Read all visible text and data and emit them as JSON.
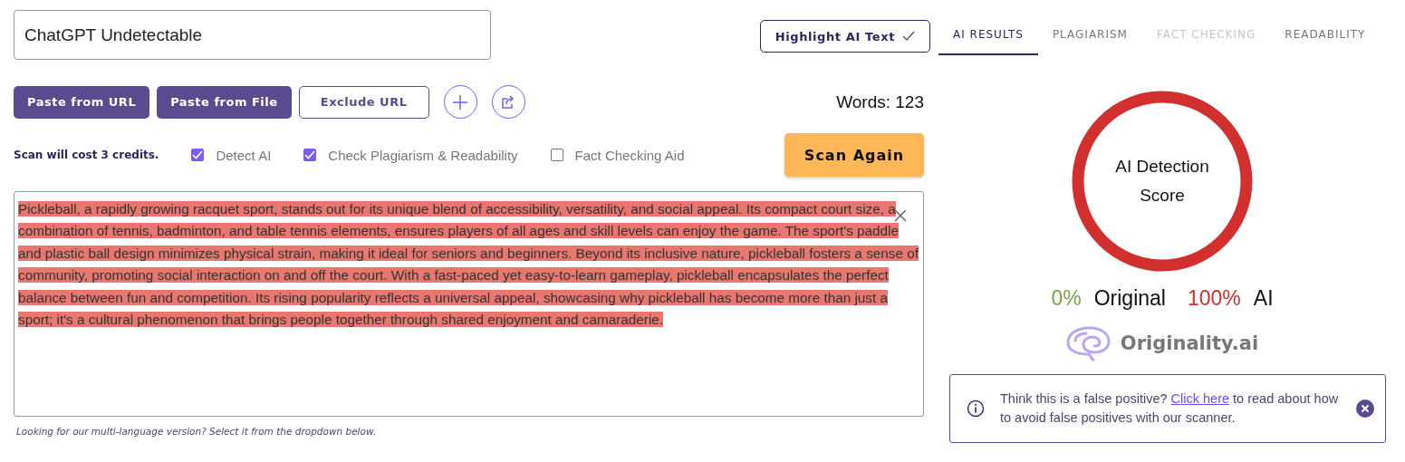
{
  "title_field": {
    "value": "ChatGPT Undetectable"
  },
  "highlight_button": {
    "label": "Highlight AI Text",
    "checked": true
  },
  "actions": [
    {
      "label": "Paste from URL",
      "kind": "filled"
    },
    {
      "label": "Paste from File",
      "kind": "filled"
    },
    {
      "label": "Exclude URL",
      "kind": "outline"
    },
    {
      "kind": "add"
    },
    {
      "kind": "export"
    }
  ],
  "word_count": "Words: 123",
  "cost_note": "Scan will cost 3 credits.",
  "options": [
    {
      "label": "Detect AI",
      "checked": true
    },
    {
      "label": "Check Plagiarism & Readability",
      "checked": true
    },
    {
      "label": "Fact Checking Aid",
      "checked": false
    }
  ],
  "scan_button": "Scan Again",
  "content": {
    "text": "Pickleball, a rapidly growing racquet sport, stands out for its unique blend of accessibility, versatility, and social appeal. Its compact court size, a combination of tennis, badminton, and table tennis elements, ensures players of all ages and skill levels can enjoy the game. The sport's paddle and plastic ball design minimizes physical strain, making it ideal for seniors and beginners. Beyond its inclusive nature, pickleball fosters a sense of community, promoting social interaction on and off the court. With a fast-paced yet easy-to-learn gameplay, pickleball encapsulates the perfect balance between fun and competition. Its rising popularity reflects a universal appeal, showcasing why pickleball has become more than just a sport; it's a cultural phenomenon that brings people together through shared enjoyment and camaraderie.",
    "highlighted": true
  },
  "footnote": "Looking for our multi-language version? Select it from the dropdown below.",
  "tabs": [
    {
      "label": "AI RESULTS",
      "selected": true,
      "disabled": false
    },
    {
      "label": "PLAGIARISM",
      "selected": false,
      "disabled": false
    },
    {
      "label": "FACT CHECKING",
      "selected": false,
      "disabled": true
    },
    {
      "label": "READABILITY",
      "selected": false,
      "disabled": false
    }
  ],
  "score": {
    "label": "AI Detection Score",
    "original_percent": "0%",
    "original_label": "Original",
    "ai_percent": "100%",
    "ai_label": "AI"
  },
  "brand": "Originality.ai",
  "notice": {
    "before": "Think this is a false positive?",
    "link": "Click here",
    "after": "to read about how to avoid false positives with our scanner."
  }
}
